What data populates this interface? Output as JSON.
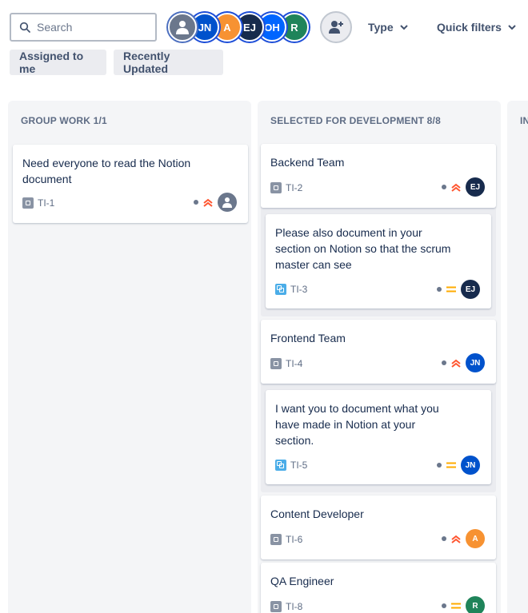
{
  "search": {
    "placeholder": "Search",
    "value": ""
  },
  "avatars": [
    {
      "initials": "",
      "name": "unassigned",
      "color": "#6b778c"
    },
    {
      "initials": "JN",
      "color": "#0052cc"
    },
    {
      "initials": "A",
      "color": "#f79232"
    },
    {
      "initials": "EJ",
      "color": "#172b4d"
    },
    {
      "initials": "OH",
      "color": "#0065ff"
    },
    {
      "initials": "R",
      "color": "#1f845a"
    }
  ],
  "filters": {
    "type_label": "Type",
    "quick_label": "Quick filters"
  },
  "chips": {
    "assigned": "Assigned to me",
    "recent": "Recently Updated"
  },
  "columns": [
    {
      "header": "GROUP WORK 1/1",
      "cards": [
        {
          "title_line1": "Need everyone to read the Notion",
          "title_line2": "document",
          "key": "TI-1",
          "priority": "high",
          "assignee": ""
        }
      ]
    },
    {
      "header": "SELECTED FOR DEVELOPMENT 8/8",
      "cards": [
        {
          "title": "Backend Team",
          "key": "TI-2",
          "priority": "high",
          "assignee": "EJ",
          "subtask": {
            "line1": "Please also document in your",
            "line2": "section on Notion so that the scrum",
            "line3": "master can see",
            "key": "TI-3",
            "priority": "medium",
            "assignee": "EJ"
          }
        },
        {
          "title": "Frontend Team",
          "key": "TI-4",
          "priority": "high",
          "assignee": "JN",
          "subtask": {
            "line1": "I want you to document what you",
            "line2": "have made in Notion at your",
            "line3": "section.",
            "key": "TI-5",
            "priority": "medium",
            "assignee": "JN"
          }
        },
        {
          "title": "Content Developer",
          "key": "TI-6",
          "priority": "high",
          "assignee": "A"
        },
        {
          "title": "QA Engineer",
          "key": "TI-8",
          "priority": "medium",
          "assignee": "R"
        }
      ]
    },
    {
      "header": "IN"
    }
  ],
  "colors": {
    "high_priority": "#ff5630",
    "medium_priority": "#ffab00",
    "ej": "#172b4d",
    "jn": "#0052cc",
    "a": "#f79232",
    "r": "#1f845a"
  },
  "icons": {
    "search": "search-icon",
    "add_people": "add-person-icon",
    "chevron": "chevron-down-icon",
    "high": "priority-high-icon",
    "medium": "priority-medium-icon"
  }
}
